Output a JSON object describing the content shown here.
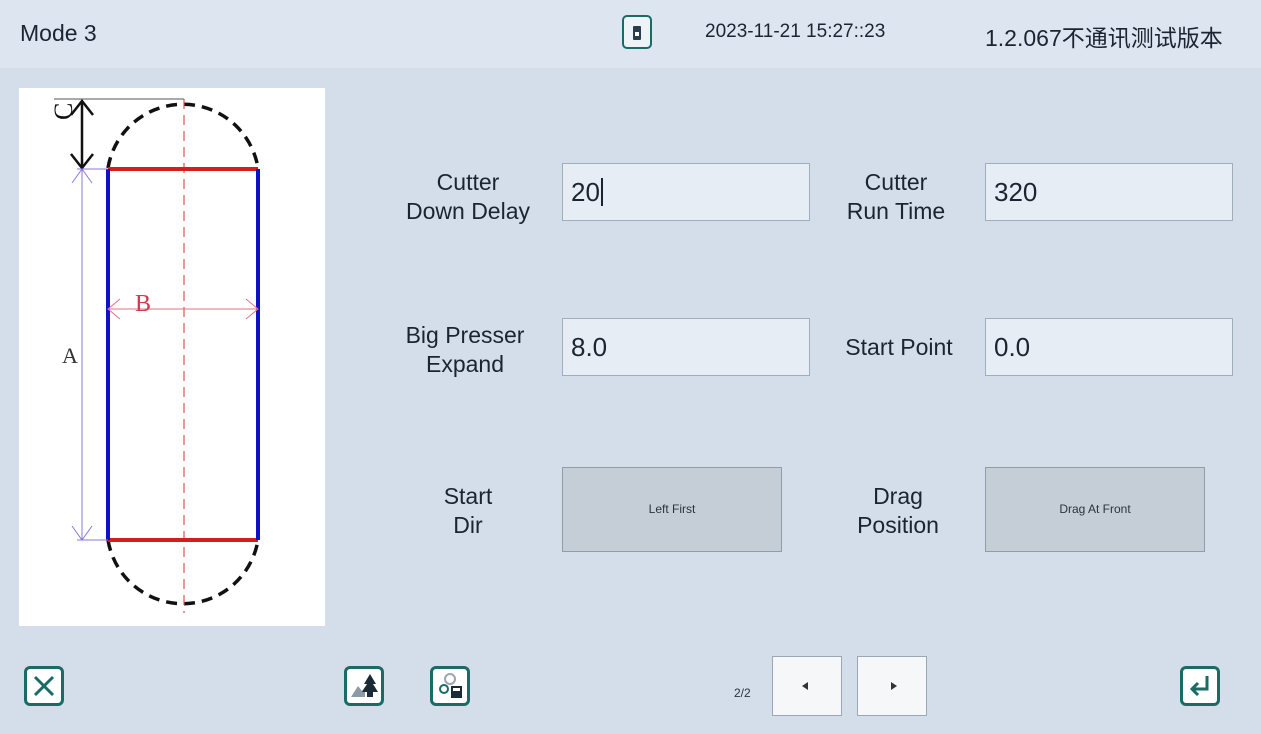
{
  "header": {
    "title": "Mode 3",
    "datetime": "2023-11-21 15:27::23",
    "version": "1.2.067不通讯测试版本"
  },
  "diagram": {
    "labels": {
      "a": "A",
      "b": "B",
      "c": "C"
    },
    "colors": {
      "straight_edges": "#1010c8",
      "cut_lines": "#d41e1e",
      "dimension": "#8a78d8",
      "b_dimension": "#e86f86"
    }
  },
  "params": {
    "cutter_down_delay": {
      "label_line1": "Cutter",
      "label_line2": "Down Delay",
      "value": "20"
    },
    "cutter_run_time": {
      "label_line1": "Cutter",
      "label_line2": "Run Time",
      "value": "320"
    },
    "big_presser_expand": {
      "label_line1": "Big Presser",
      "label_line2": "Expand",
      "value": "8.0"
    },
    "start_point": {
      "label": "Start Point",
      "value": "0.0"
    },
    "start_dir": {
      "label_line1": "Start",
      "label_line2": "Dir",
      "value": "Left First"
    },
    "drag_position": {
      "label_line1": "Drag",
      "label_line2": "Position",
      "value": "Drag At Front"
    }
  },
  "footer": {
    "page_indicator": "2/2",
    "icons": [
      "close-icon",
      "image-tree-icon",
      "settings-save-icon",
      "prev-arrow-icon",
      "next-arrow-icon",
      "enter-icon"
    ]
  },
  "colors": {
    "background": "#d3deea",
    "accent": "#1a6b66"
  }
}
